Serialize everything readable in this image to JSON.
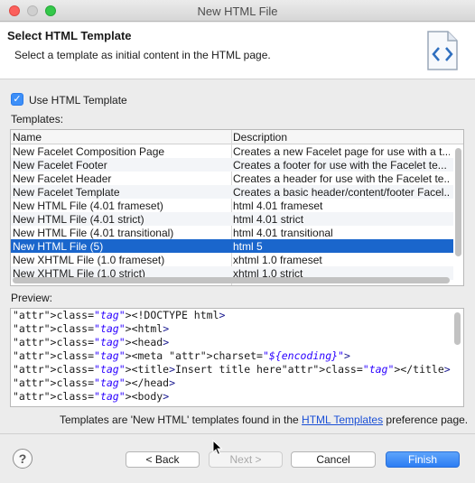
{
  "window": {
    "title": "New HTML File"
  },
  "header": {
    "title": "Select HTML Template",
    "description": "Select a template as initial content in the HTML page.",
    "icon": "html-file-icon"
  },
  "use_template": {
    "label": "Use HTML Template",
    "checked": true
  },
  "templates": {
    "label": "Templates:",
    "columns": [
      "Name",
      "Description"
    ],
    "rows": [
      {
        "name": "New Facelet Composition Page",
        "description": "Creates a new Facelet page for use with a t..."
      },
      {
        "name": "New Facelet Footer",
        "description": "Creates a footer for use with the Facelet te..."
      },
      {
        "name": "New Facelet Header",
        "description": "Creates a header for use with the Facelet te..."
      },
      {
        "name": "New Facelet Template",
        "description": "Creates a basic header/content/footer Facel..."
      },
      {
        "name": "New HTML File (4.01 frameset)",
        "description": "html 4.01 frameset"
      },
      {
        "name": "New HTML File (4.01 strict)",
        "description": "html 4.01 strict"
      },
      {
        "name": "New HTML File (4.01 transitional)",
        "description": "html 4.01 transitional"
      },
      {
        "name": "New HTML File (5)",
        "description": "html 5"
      },
      {
        "name": "New XHTML File (1.0 frameset)",
        "description": "xhtml 1.0 frameset"
      },
      {
        "name": "New XHTML File (1.0 strict)",
        "description": "xhtml 1.0 strict"
      }
    ],
    "selected_index": 7
  },
  "preview": {
    "label": "Preview:",
    "lines": [
      "<!DOCTYPE html>",
      "<html>",
      "<head>",
      "<meta charset=\"${encoding}\">",
      "<title>Insert title here</title>",
      "</head>",
      "<body>"
    ]
  },
  "footer_note": {
    "before": "Templates are 'New HTML' templates found in the ",
    "link": "HTML Templates",
    "after": " preference page."
  },
  "buttons": {
    "help": "?",
    "back": "< Back",
    "next": "Next >",
    "cancel": "Cancel",
    "finish": "Finish"
  },
  "colors": {
    "selection": "#1a66cc",
    "primary_button": "#2c7df3",
    "link": "#1a4fd6"
  }
}
